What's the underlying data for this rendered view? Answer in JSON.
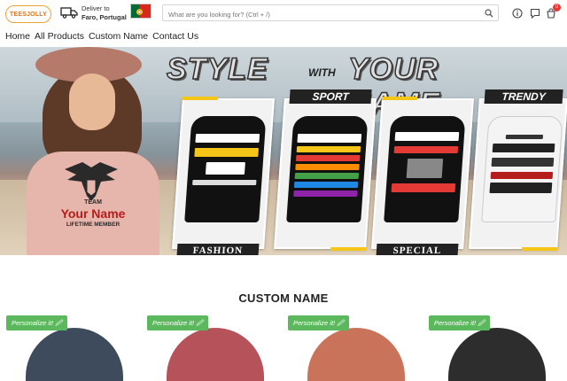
{
  "header": {
    "logo_text": "TEESJOLLY",
    "deliver_label": "Deliver to",
    "deliver_location": "Faro, Portugal",
    "flag_icon": "portugal-flag-icon",
    "search_placeholder": "What are you looking for? (Ctrl + /)",
    "cart_count": "0",
    "colors": {
      "accent": "#f0a13a",
      "badge": "#e53935"
    }
  },
  "nav": {
    "items": [
      "Home",
      "All Products",
      "Custom Name",
      "Contact Us"
    ]
  },
  "hero": {
    "title_left": "STYLE",
    "title_mid": "WITH",
    "title_right": "YOUR NAME",
    "shirt": {
      "team": "TEAM",
      "name": "Your Name",
      "member": "LIFETIME MEMBER"
    },
    "panels": [
      {
        "head": "",
        "foot": "FASHION",
        "tee_text": "IF YOUR NAME CAN'T FIX IT"
      },
      {
        "head": "SPORT",
        "foot": "",
        "tee_text": "YOUR NAME"
      },
      {
        "head": "",
        "foot": "SPECIAL",
        "tee_text": "I'M A YOUR NAME"
      },
      {
        "head": "TRENDY",
        "foot": "",
        "tee_text": "NEVER UNDERESTIMATE YOUR NAME"
      }
    ]
  },
  "section": {
    "title": "CUSTOM NAME"
  },
  "products": [
    {
      "badge": "Personalize it! 🖉",
      "color": "#3e4b5c"
    },
    {
      "badge": "Personalize it! 🖉",
      "color": "#b5525a"
    },
    {
      "badge": "Personalize it! 🖉",
      "color": "#c9745a"
    },
    {
      "badge": "Personalize it! 🖉",
      "color": "#2d2d2d"
    }
  ]
}
